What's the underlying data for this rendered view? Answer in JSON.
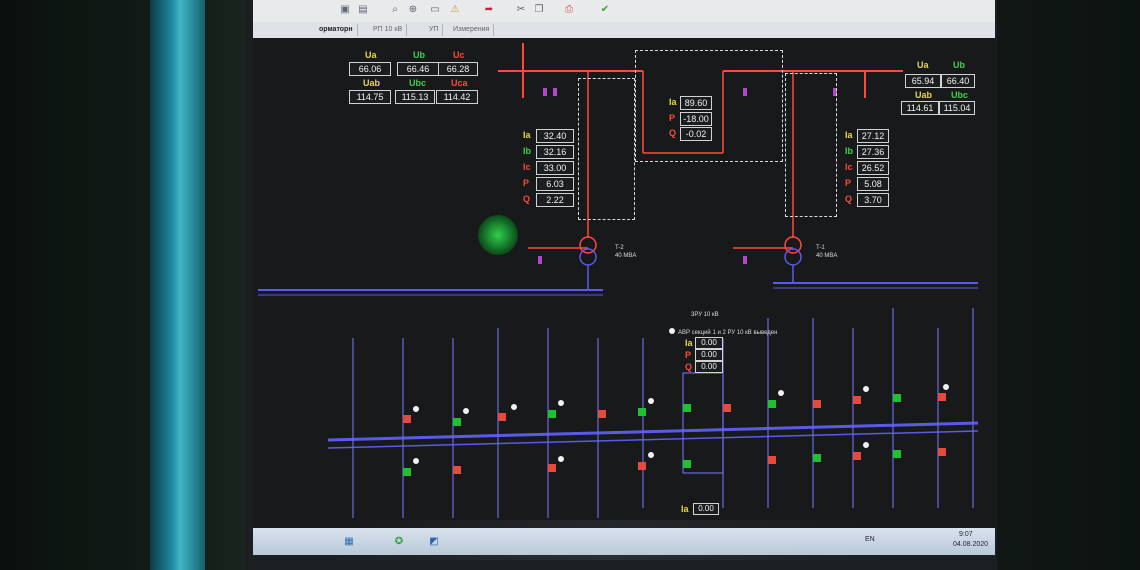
{
  "toolbar": {
    "icons": [
      "floppy-icon",
      "print-icon",
      "search-icon",
      "zoom-icon",
      "document-icon",
      "warning-icon",
      "arrow-icon",
      "cut-icon",
      "copy-icon",
      "printer-icon",
      "check-icon"
    ]
  },
  "tabs": [
    "орматорн",
    "РП 10 кВ",
    "УП",
    "Измерения"
  ],
  "left_voltages": {
    "ua_label": "Ua",
    "ub_label": "Ub",
    "uc_label": "Uc",
    "ua": "66.06",
    "ub": "66.46",
    "uc": "66.28",
    "uab_label": "Uab",
    "ubc_label": "Ubc",
    "uca_label": "Uca",
    "uab": "114.75",
    "ubc": "115.13",
    "uca": "114.42"
  },
  "right_voltages": {
    "ua_label": "Ua",
    "ub_label": "Ub",
    "ua": "65.94",
    "ub": "66.40",
    "uab_label": "Uab",
    "ubc_label": "Ubc",
    "uab": "114.61",
    "ubc": "115.04"
  },
  "left_feeder": {
    "ia_label": "Ia",
    "ib_label": "Ib",
    "ic_label": "Ic",
    "p_label": "P",
    "q_label": "Q",
    "ia": "32.40",
    "ib": "32.16",
    "ic": "33.00",
    "p": "6.03",
    "q": "2.22"
  },
  "center_feeder": {
    "ia_label": "Ia",
    "p_label": "P",
    "q_label": "Q",
    "ia": "89.60",
    "p": "-18.00",
    "q": "-0.02"
  },
  "right_feeder": {
    "ia_label": "Ia",
    "ib_label": "Ib",
    "ic_label": "Ic",
    "p_label": "P",
    "q_label": "Q",
    "ia": "27.12",
    "ib": "27.36",
    "ic": "26.52",
    "p": "5.08",
    "q": "3.70"
  },
  "transformers": [
    {
      "name": "T-2",
      "rating": "40 MBA"
    },
    {
      "name": "T-1",
      "rating": "40 MBA"
    }
  ],
  "bus_label": "3РУ 10 кВ",
  "avr_label": "АВР секций 1 и 2 РУ 10 кВ выведен",
  "avr_panel": {
    "ia_label": "Ia",
    "p_label": "P",
    "q_label": "Q",
    "ia": "0.00",
    "p": "0.00",
    "q": "0.00"
  },
  "bottom_panel": {
    "ia_label": "Ia",
    "ia": "0.00"
  },
  "clock": {
    "time": "9:07",
    "date": "04.08.2020"
  },
  "language": "EN",
  "colors": {
    "line_red": "#ff4a3a",
    "line_blue": "#5a5ae8",
    "on_green": "#1ec22f",
    "off_red": "#e54a3c",
    "value_yellow": "#e8d84a",
    "value_green": "#3fd04a"
  }
}
